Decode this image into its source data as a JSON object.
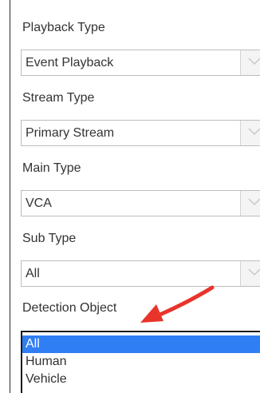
{
  "form": {
    "playback_type": {
      "label": "Playback Type",
      "value": "Event Playback"
    },
    "stream_type": {
      "label": "Stream Type",
      "value": "Primary Stream"
    },
    "main_type": {
      "label": "Main Type",
      "value": "VCA"
    },
    "sub_type": {
      "label": "Sub Type",
      "value": "All"
    },
    "detection_object": {
      "label": "Detection Object",
      "options": [
        "All",
        "Human",
        "Vehicle"
      ],
      "selected": "All"
    }
  },
  "icons": {
    "dropdown": "chevron-down-icon",
    "annotation": "red-arrow-icon"
  },
  "colors": {
    "selection": "#2f7ef3",
    "annotation_arrow": "#e8342b",
    "select_border": "#bdbdbd",
    "list_border": "#1a1a1a"
  }
}
